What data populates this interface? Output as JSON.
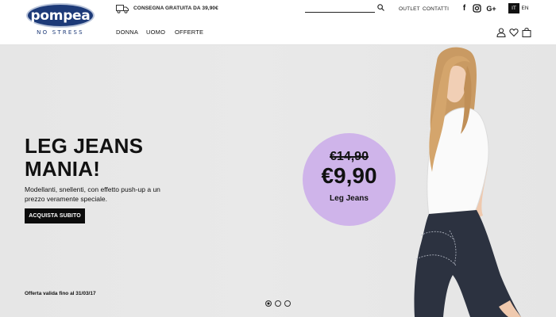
{
  "brand": {
    "logo_text": "pompea",
    "tagline": "NO STRESS"
  },
  "topbar": {
    "shipping_icon": "truck-icon",
    "shipping_text": "CONSEGNA GRATUITA DA 39,90€",
    "search_placeholder": "",
    "links": [
      "OUTLET",
      "CONTATTI"
    ],
    "social": [
      {
        "name": "facebook-icon",
        "glyph": "f"
      },
      {
        "name": "instagram-icon",
        "glyph": ""
      },
      {
        "name": "google-plus-icon",
        "glyph": "G+"
      }
    ],
    "languages": [
      {
        "code": "IT",
        "active": true
      },
      {
        "code": "EN",
        "active": false
      }
    ]
  },
  "nav": {
    "items": [
      "DONNA",
      "UOMO",
      "OFFERTE"
    ]
  },
  "utility_icons": [
    "user-icon",
    "heart-icon",
    "bag-icon"
  ],
  "hero": {
    "headline_line1": "LEG JEANS",
    "headline_line2": "MANIA!",
    "subtext": "Modellanti, snellenti, con effetto push-up a un prezzo veramente speciale.",
    "cta": "ACQUISTA SUBITO",
    "validity": "Offerta valida fino al 31/03/17",
    "price_old": "€14,90",
    "price_new": "€9,90",
    "price_label": "Leg Jeans",
    "badge_color": "#cfb4ea",
    "slides": [
      {
        "active": true
      },
      {
        "active": false
      },
      {
        "active": false
      }
    ]
  }
}
